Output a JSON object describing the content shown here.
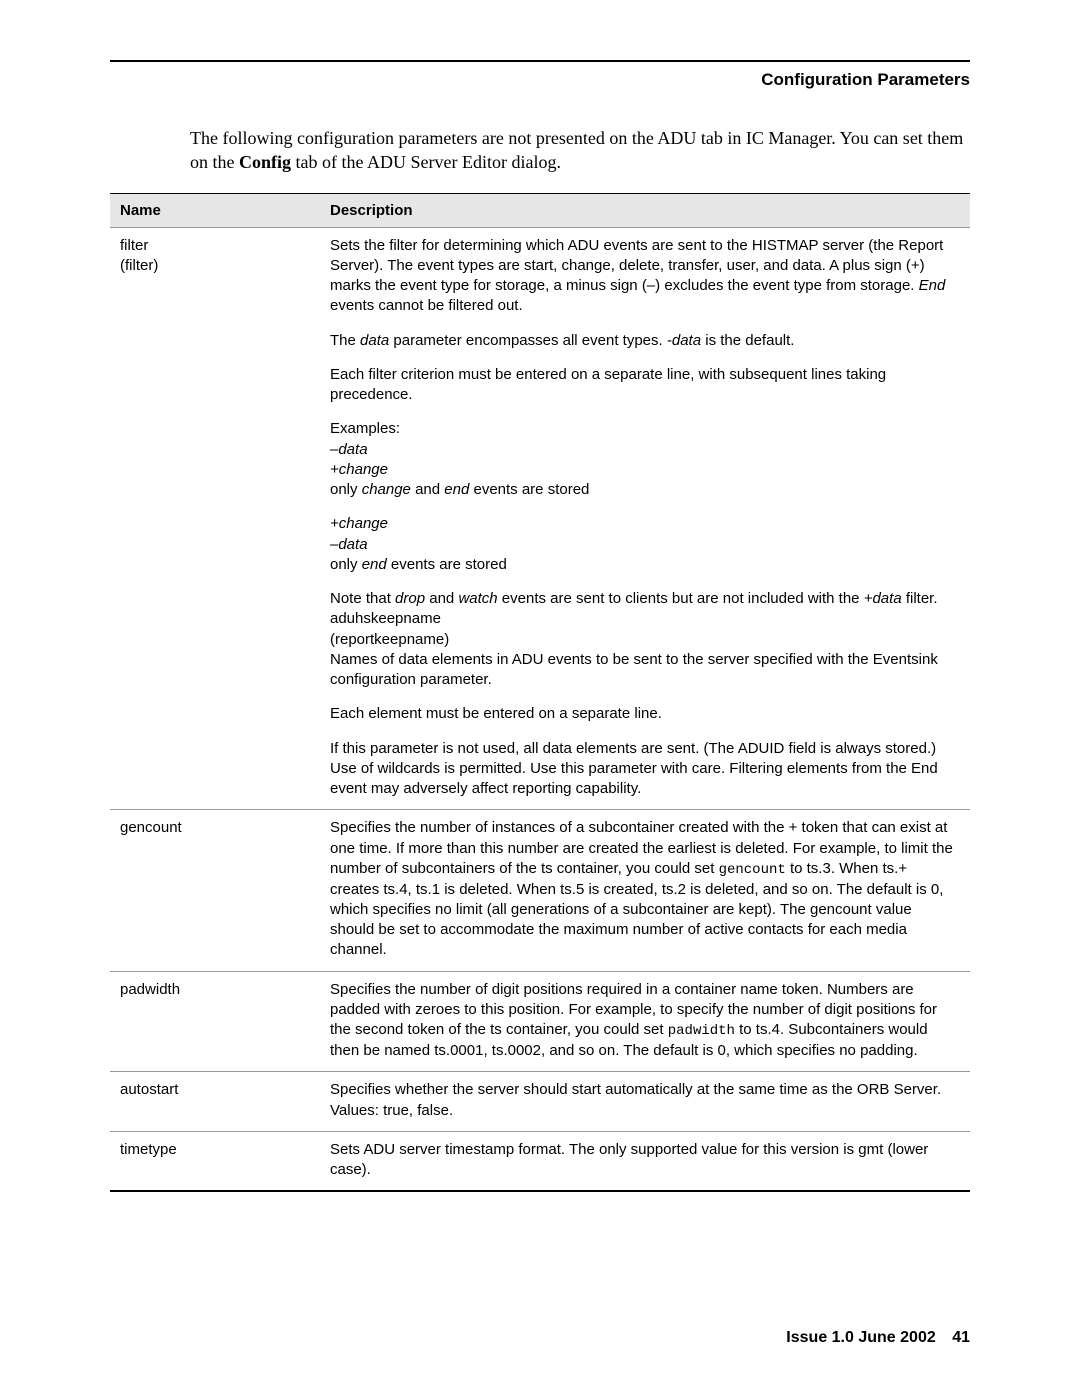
{
  "header": {
    "title": "Configuration Parameters"
  },
  "intro": {
    "line1": "The following configuration parameters are not presented on the ADU tab in IC Manager. You can set them on the ",
    "bold": "Config",
    "line2": " tab of the ADU Server Editor dialog."
  },
  "table": {
    "headers": {
      "name": "Name",
      "desc": "Description"
    },
    "rows": [
      {
        "name": "filter\n(filter)",
        "desc_html": "<p>Sets the filter for determining which ADU events are sent to the HISTMAP server (the Report Server). The event types are start, change, delete, transfer, user, and data. A plus sign (+) marks the event type for storage, a minus sign (&ndash;) excludes the event type from storage. <i>End</i> events cannot be filtered out.</p><p>The <i>data</i> parameter encompasses all event types. <i>-data</i> is the default.</p><p>Each filter criterion must be entered on a separate line, with subsequent lines taking precedence.</p><p>Examples:<br><i>&ndash;data</i><br><i>+change</i><br>only <i>change</i> and <i>end</i> events are stored</p><p><i>+change</i><br><i>&ndash;data</i><br>only <i>end</i> events are stored</p><p>Note that <i>drop</i> and <i>watch</i> events are sent to clients but are not included with the <i>+data</i> filter.<br>aduhskeepname<br>(reportkeepname)<br>Names of data elements in ADU events to be sent to the server specified with the Eventsink configuration parameter.</p><p>Each element must be entered on a separate line.</p><p>If this parameter is not used, all data elements are sent. (The ADUID field is always stored.) Use of wildcards is permitted. Use this parameter with care. Filtering elements from the End event may adversely affect reporting capability.</p>"
      },
      {
        "name": "gencount",
        "desc_html": "<p>Specifies the number of instances of a subcontainer created with the + token that can exist at one time. If more than this number are created the earliest is deleted. For example, to limit the number of subcontainers of the ts container, you could set <span class=\"mono\">gencount</span> to ts.3. When ts.+ creates ts.4, ts.1 is deleted. When ts.5 is created, ts.2 is deleted, and so on. The default is 0, which specifies no limit (all generations of a subcontainer are kept). The gencount value should be set to accommodate the maximum number of active contacts for each media channel.</p>"
      },
      {
        "name": "padwidth",
        "desc_html": "<p>Specifies the number of digit positions required in a container name token. Numbers are padded with zeroes to this position. For example, to specify the number of digit positions for the second token of the ts container, you could set <span class=\"mono\">padwidth</span> to ts.4. Subcontainers would then be named ts.0001, ts.0002, and so on. The default is 0, which specifies no padding.</p>"
      },
      {
        "name": "autostart",
        "desc_html": "<p>Specifies whether the server should start automatically at the same time as the ORB Server. Values: true, false.</p>"
      },
      {
        "name": "timetype",
        "desc_html": "<p>Sets ADU server timestamp format. The only supported value for this version is gmt (lower case).</p>"
      }
    ]
  },
  "footer": {
    "issue": "Issue 1.0",
    "date": "June 2002",
    "page": "41"
  }
}
